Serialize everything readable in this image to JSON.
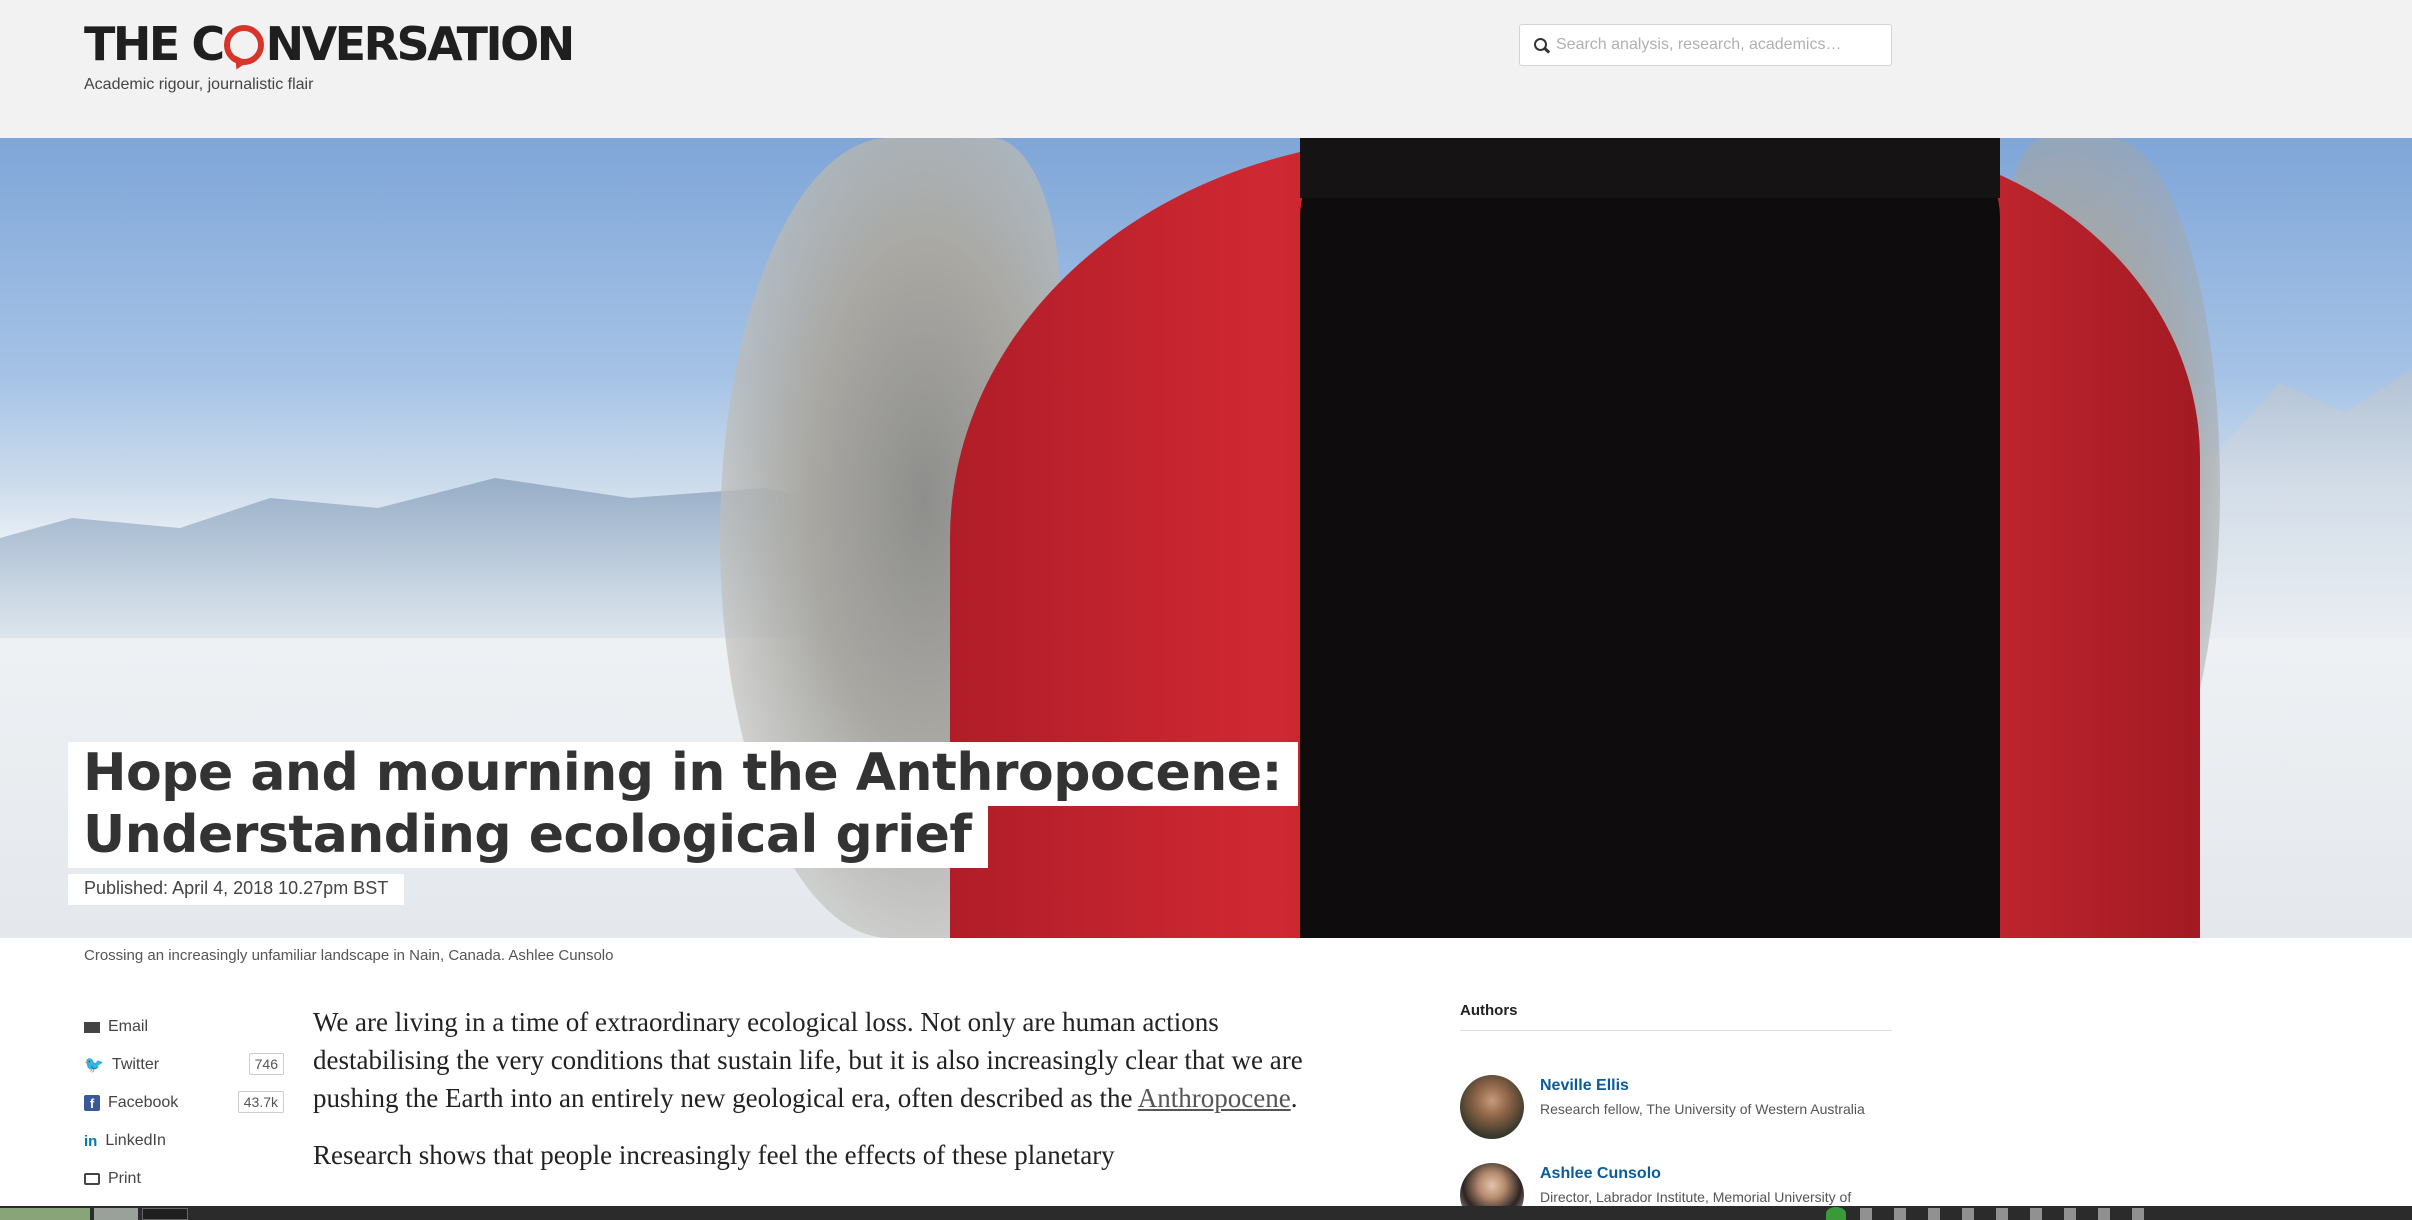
{
  "header": {
    "logo_text_before": "THE C",
    "logo_text_after": "NVERSATION",
    "tagline": "Academic rigour, journalistic flair",
    "search_placeholder": "Search analysis, research, academics…"
  },
  "hero": {
    "title_line_1": "Hope and mourning in the Anthropocene:",
    "title_line_2": "Understanding ecological grief",
    "published": "Published: April 4, 2018 10.27pm BST",
    "caption": "Crossing an increasingly unfamiliar landscape in Nain, Canada. Ashlee Cunsolo"
  },
  "share": {
    "email": "Email",
    "twitter": "Twitter",
    "twitter_count": "746",
    "facebook": "Facebook",
    "facebook_count": "43.7k",
    "linkedin": "LinkedIn",
    "print": "Print"
  },
  "article": {
    "p1_before": "We are living in a time of extraordinary ecological loss. Not only are human actions destabilising the very conditions that sustain life, but it is also increasingly clear that we are pushing the Earth into an entirely new geological era, often described as the ",
    "p1_link": "Anthropocene",
    "p1_after": ".",
    "p2": "Research shows that people increasingly feel the effects of these planetary"
  },
  "authors": {
    "heading": "Authors",
    "list": [
      {
        "name": "Neville Ellis",
        "role": "Research fellow, The University of Western Australia"
      },
      {
        "name": "Ashlee Cunsolo",
        "role": "Director, Labrador Institute, Memorial University of Newfoundland"
      }
    ]
  },
  "colors": {
    "brand_red": "#d8352a",
    "author_link": "#0a5b9b",
    "header_bg": "#f2f2f2"
  }
}
